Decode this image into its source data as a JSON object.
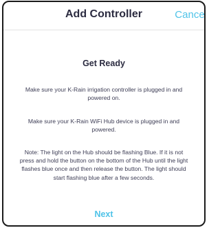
{
  "header": {
    "title": "Add Controller",
    "cancel_label": "Cancel"
  },
  "main": {
    "heading": "Get Ready",
    "paragraphs": [
      "Make sure your K-Rain irrigation controller is plugged in and powered on.",
      "Make sure your K-Rain WiFi Hub device is plugged in and powered.",
      "Note: The light on the Hub should be flashing Blue. If it is not press and hold the button on the bottom of the Hub until the light flashes blue once and then release the button. The light should start flashing blue after a few seconds."
    ],
    "next_label": "Next"
  },
  "colors": {
    "accent": "#4fc3e8",
    "text": "#2b2b40",
    "body_text": "#3d3d55"
  }
}
